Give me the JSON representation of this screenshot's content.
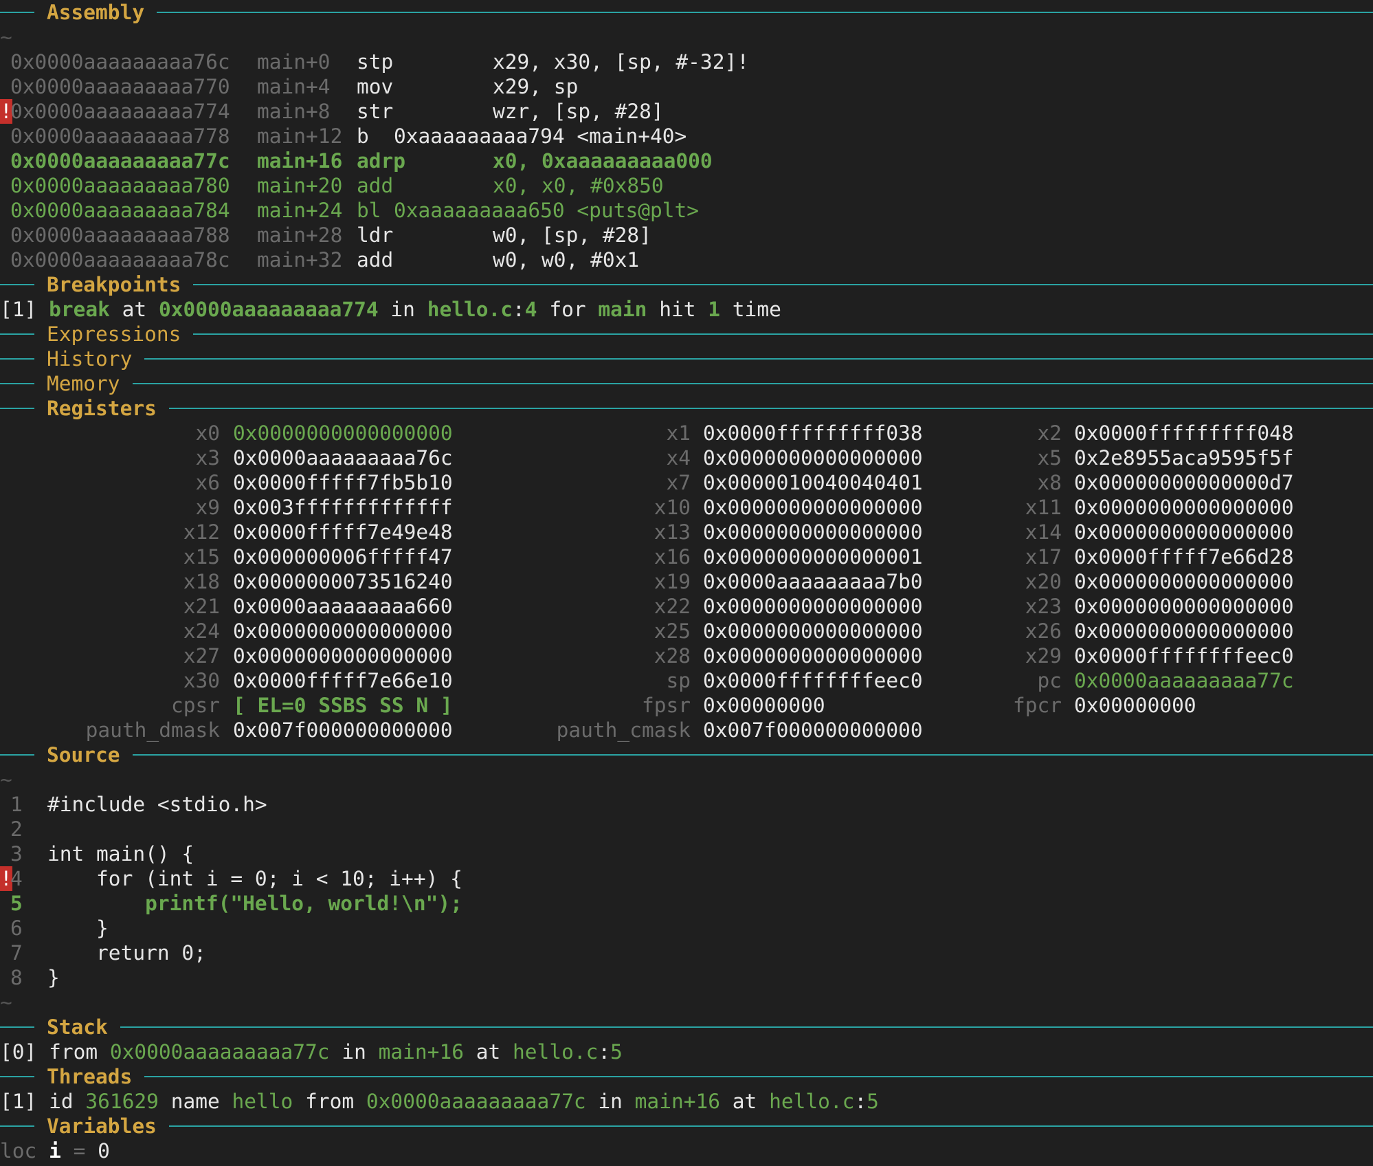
{
  "sections": {
    "assembly": "Assembly",
    "breakpoints": "Breakpoints",
    "expressions": "Expressions",
    "history": "History",
    "memory": "Memory",
    "registers": "Registers",
    "source": "Source",
    "stack": "Stack",
    "threads": "Threads",
    "variables": "Variables"
  },
  "tilde": "~",
  "bp_marker": "!",
  "assembly": [
    {
      "addr": "0x0000aaaaaaaaa76c",
      "off": "main+0",
      "op": "stp",
      "args": "x29, x30, [sp, #-32]!",
      "state": "normal"
    },
    {
      "addr": "0x0000aaaaaaaaa770",
      "off": "main+4",
      "op": "mov",
      "args": "x29, sp",
      "state": "normal"
    },
    {
      "addr": "0x0000aaaaaaaaa774",
      "off": "main+8",
      "op": "str",
      "args": "wzr, [sp, #28]",
      "state": "breakpoint"
    },
    {
      "addr": "0x0000aaaaaaaaa778",
      "off": "main+12",
      "op": "b",
      "args": "0xaaaaaaaaa794 <main+40>",
      "state": "normal"
    },
    {
      "addr": "0x0000aaaaaaaaa77c",
      "off": "main+16",
      "op": "adrp",
      "args": "x0, 0xaaaaaaaaa000",
      "state": "current"
    },
    {
      "addr": "0x0000aaaaaaaaa780",
      "off": "main+20",
      "op": "add",
      "args": "x0, x0, #0x850",
      "state": "line"
    },
    {
      "addr": "0x0000aaaaaaaaa784",
      "off": "main+24",
      "op": "bl",
      "args": "0xaaaaaaaaa650 <puts@plt>",
      "state": "line"
    },
    {
      "addr": "0x0000aaaaaaaaa788",
      "off": "main+28",
      "op": "ldr",
      "args": "w0, [sp, #28]",
      "state": "normal"
    },
    {
      "addr": "0x0000aaaaaaaaa78c",
      "off": "main+32",
      "op": "add",
      "args": "w0, w0, #0x1",
      "state": "normal"
    }
  ],
  "breakpoint": {
    "index": "[1]",
    "kw_break": "break",
    "at": "at",
    "addr": "0x0000aaaaaaaaa774",
    "in": "in",
    "file": "hello.c",
    "colon": ":",
    "line": "4",
    "for": "for",
    "func": "main",
    "hit": "hit",
    "count": "1",
    "time": "time"
  },
  "registers": [
    [
      {
        "n": "x0",
        "v": "0x0000000000000000",
        "hl": true
      },
      {
        "n": "x1",
        "v": "0x0000fffffffff038"
      },
      {
        "n": "x2",
        "v": "0x0000fffffffff048"
      }
    ],
    [
      {
        "n": "x3",
        "v": "0x0000aaaaaaaaa76c"
      },
      {
        "n": "x4",
        "v": "0x0000000000000000"
      },
      {
        "n": "x5",
        "v": "0x2e8955aca9595f5f"
      }
    ],
    [
      {
        "n": "x6",
        "v": "0x0000fffff7fb5b10"
      },
      {
        "n": "x7",
        "v": "0x0000010040040401"
      },
      {
        "n": "x8",
        "v": "0x00000000000000d7"
      }
    ],
    [
      {
        "n": "x9",
        "v": "0x003fffffffffffff"
      },
      {
        "n": "x10",
        "v": "0x0000000000000000"
      },
      {
        "n": "x11",
        "v": "0x0000000000000000"
      }
    ],
    [
      {
        "n": "x12",
        "v": "0x0000fffff7e49e48"
      },
      {
        "n": "x13",
        "v": "0x0000000000000000"
      },
      {
        "n": "x14",
        "v": "0x0000000000000000"
      }
    ],
    [
      {
        "n": "x15",
        "v": "0x000000006fffff47"
      },
      {
        "n": "x16",
        "v": "0x0000000000000001"
      },
      {
        "n": "x17",
        "v": "0x0000fffff7e66d28"
      }
    ],
    [
      {
        "n": "x18",
        "v": "0x0000000073516240"
      },
      {
        "n": "x19",
        "v": "0x0000aaaaaaaaa7b0"
      },
      {
        "n": "x20",
        "v": "0x0000000000000000"
      }
    ],
    [
      {
        "n": "x21",
        "v": "0x0000aaaaaaaaa660"
      },
      {
        "n": "x22",
        "v": "0x0000000000000000"
      },
      {
        "n": "x23",
        "v": "0x0000000000000000"
      }
    ],
    [
      {
        "n": "x24",
        "v": "0x0000000000000000"
      },
      {
        "n": "x25",
        "v": "0x0000000000000000"
      },
      {
        "n": "x26",
        "v": "0x0000000000000000"
      }
    ],
    [
      {
        "n": "x27",
        "v": "0x0000000000000000"
      },
      {
        "n": "x28",
        "v": "0x0000000000000000"
      },
      {
        "n": "x29",
        "v": "0x0000ffffffffeec0"
      }
    ],
    [
      {
        "n": "x30",
        "v": "0x0000fffff7e66e10"
      },
      {
        "n": "sp",
        "v": "0x0000ffffffffeec0"
      },
      {
        "n": "pc",
        "v": "0x0000aaaaaaaaa77c",
        "hl": true
      }
    ],
    [
      {
        "n": "cpsr",
        "v": "[ EL=0 SSBS SS N ]",
        "hl": true,
        "bold": true
      },
      {
        "n": "fpsr",
        "v": "0x00000000"
      },
      {
        "n": "fpcr",
        "v": "0x00000000"
      }
    ],
    [
      {
        "n": "pauth_dmask",
        "v": "0x007f000000000000"
      },
      {
        "n": "pauth_cmask",
        "v": "0x007f000000000000"
      }
    ]
  ],
  "source": [
    {
      "num": "1",
      "code": "#include <stdio.h>",
      "state": "normal"
    },
    {
      "num": "2",
      "code": "",
      "state": "normal"
    },
    {
      "num": "3",
      "code": "int main() {",
      "state": "normal"
    },
    {
      "num": "4",
      "code": "    for (int i = 0; i < 10; i++) {",
      "state": "breakpoint"
    },
    {
      "num": "5",
      "code": "        printf(\"Hello, world!\\n\");",
      "state": "current"
    },
    {
      "num": "6",
      "code": "    }",
      "state": "normal"
    },
    {
      "num": "7",
      "code": "    return 0;",
      "state": "normal"
    },
    {
      "num": "8",
      "code": "}",
      "state": "normal"
    }
  ],
  "stack": {
    "index": "[0]",
    "from": "from",
    "addr": "0x0000aaaaaaaaa77c",
    "in": "in",
    "func": "main+16",
    "at": "at",
    "file": "hello.c",
    "colon": ":",
    "line": "5"
  },
  "thread": {
    "index": "[1]",
    "id_kw": "id",
    "id": "361629",
    "name_kw": "name",
    "name": "hello",
    "from": "from",
    "addr": "0x0000aaaaaaaaa77c",
    "in": "in",
    "func": "main+16",
    "at": "at",
    "file": "hello.c",
    "colon": ":",
    "line": "5"
  },
  "variable": {
    "scope": "loc",
    "name": "i",
    "eq": "=",
    "value": "0"
  }
}
